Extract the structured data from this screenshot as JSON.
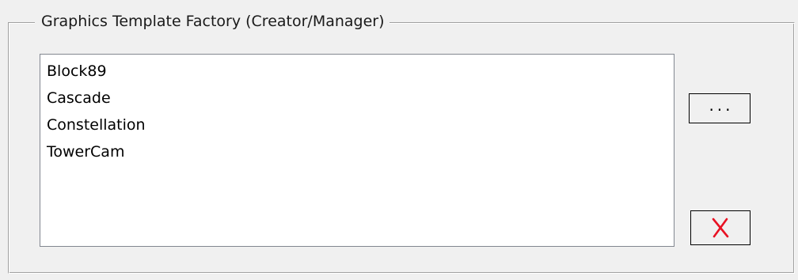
{
  "group": {
    "title": "Graphics Template Factory (Creator/Manager)"
  },
  "template_list": {
    "items": [
      {
        "label": "Block89"
      },
      {
        "label": "Cascade"
      },
      {
        "label": "Constellation"
      },
      {
        "label": "TowerCam"
      }
    ]
  },
  "buttons": {
    "browse_label": "...",
    "delete_icon": "red-x-delete-icon",
    "delete_color": "#e81123"
  }
}
